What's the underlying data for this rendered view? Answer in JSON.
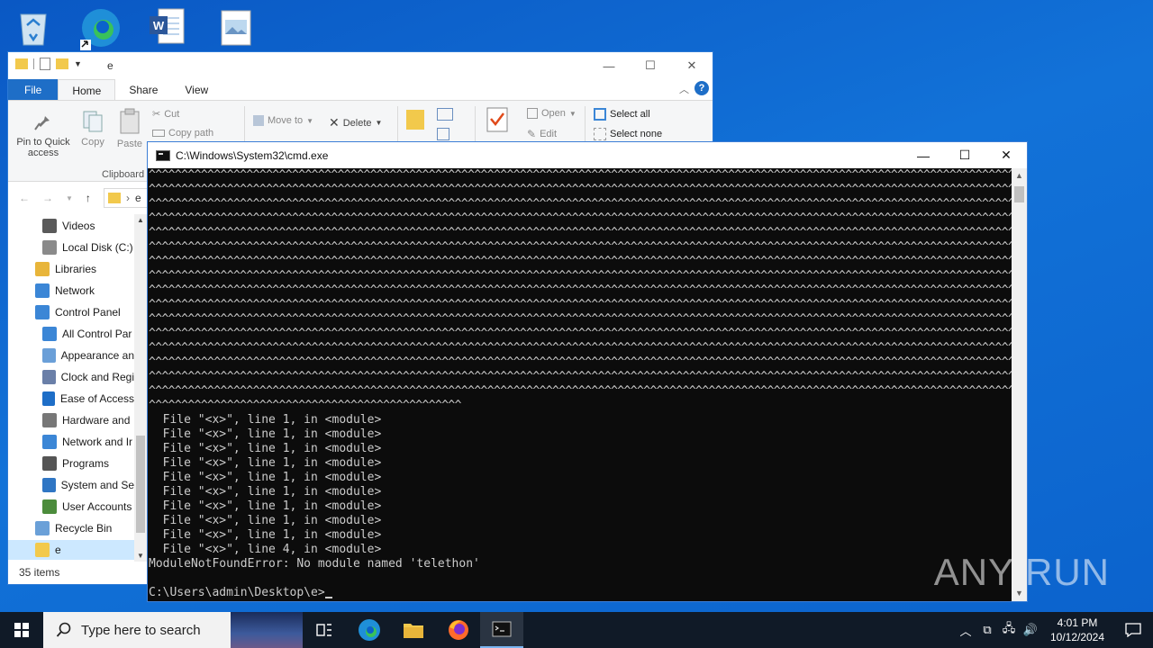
{
  "desktop": {
    "icons": [
      "recycle-bin",
      "edge",
      "word-document",
      "image-file"
    ]
  },
  "explorer": {
    "title": "e",
    "tabs": {
      "file": "File",
      "home": "Home",
      "share": "Share",
      "view": "View"
    },
    "help": "?",
    "ribbon": {
      "pin": "Pin to Quick access",
      "copy": "Copy",
      "paste": "Paste",
      "cut": "Cut",
      "copy_path": "Copy path",
      "clipboard_group": "Clipboard",
      "move_to": "Move to",
      "delete": "Delete",
      "open": "Open",
      "edit": "Edit",
      "select_all": "Select all",
      "select_none": "Select none"
    },
    "address": "e",
    "nav": [
      {
        "label": "Videos",
        "color": "#5a5a5a"
      },
      {
        "label": "Local Disk (C:)",
        "color": "#8a8a8a"
      },
      {
        "label": "Libraries",
        "color": "#e8b53a"
      },
      {
        "label": "Network",
        "color": "#3b86d6"
      },
      {
        "label": "Control Panel",
        "color": "#3b86d6"
      },
      {
        "label": "All Control Par",
        "color": "#3b86d6"
      },
      {
        "label": "Appearance an",
        "color": "#6a9fd8"
      },
      {
        "label": "Clock and Regi",
        "color": "#6a7fa8"
      },
      {
        "label": "Ease of Access",
        "color": "#1e6ec7"
      },
      {
        "label": "Hardware and",
        "color": "#777777"
      },
      {
        "label": "Network and Ir",
        "color": "#3b86d6"
      },
      {
        "label": "Programs",
        "color": "#555555"
      },
      {
        "label": "System and Se",
        "color": "#2f76c4"
      },
      {
        "label": "User Accounts",
        "color": "#4c8c3c"
      },
      {
        "label": "Recycle Bin",
        "color": "#6aa0d8"
      },
      {
        "label": "e",
        "color": "#f2c94c"
      }
    ],
    "status": "35 items"
  },
  "cmd": {
    "title": "C:\\Windows\\System32\\cmd.exe",
    "caret_line": "^^^^^^^^^^^^^^^^^^^^^^^^^^^^^^^^^^^^^^^^^^^^^^^^^^^^^^^^^^^^^^^^^^^^^^^^^^^^^^^^^^^^^^^^^^^^^^^^^^^^^^^^^^^^^^^^^^^^^^^^^^^^^^^^^^^^^^^^^^^^^^^^^^^^^^^^^^^^^^^^^^^^^^^^^^^^^^^^^^^^^^^",
    "caret_short": "^^^^^^^^^^^^^^^^^^^^^^^^^^^^^^^^^^^^^^^^^^^^^^^^",
    "trace": [
      "  File \"<x>\", line 1, in <module>",
      "  File \"<x>\", line 1, in <module>",
      "  File \"<x>\", line 1, in <module>",
      "  File \"<x>\", line 1, in <module>",
      "  File \"<x>\", line 1, in <module>",
      "  File \"<x>\", line 1, in <module>",
      "  File \"<x>\", line 1, in <module>",
      "  File \"<x>\", line 1, in <module>",
      "  File \"<x>\", line 1, in <module>",
      "  File \"<x>\", line 4, in <module>"
    ],
    "error": "ModuleNotFoundError: No module named 'telethon'",
    "prompt": "C:\\Users\\admin\\Desktop\\e>"
  },
  "watermark": "ANY RUN",
  "taskbar": {
    "search_placeholder": "Type here to search",
    "time": "4:01 PM",
    "date": "10/12/2024"
  }
}
